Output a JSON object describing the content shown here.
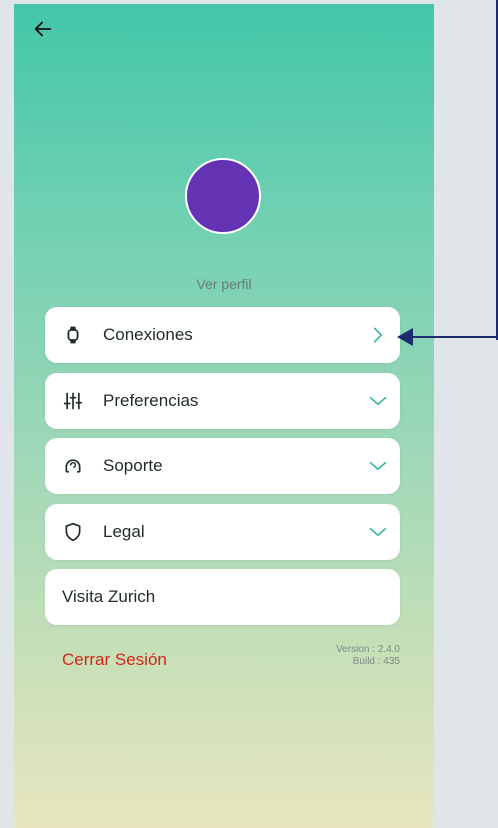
{
  "header": {
    "back_icon": "arrow-left-icon"
  },
  "profile": {
    "view_label": "Ver perfil",
    "avatar_color": "#6433b3"
  },
  "menu": [
    {
      "label": "Conexiones",
      "icon": "watch-icon",
      "indicator": "chevron-right-icon"
    },
    {
      "label": "Preferencias",
      "icon": "sliders-icon",
      "indicator": "chevron-down-icon"
    },
    {
      "label": "Soporte",
      "icon": "support-icon",
      "indicator": "chevron-down-icon"
    },
    {
      "label": "Legal",
      "icon": "shield-icon",
      "indicator": "chevron-down-icon"
    },
    {
      "label": "Visita Zurich"
    }
  ],
  "footer": {
    "logout_label": "Cerrar Sesión",
    "version": "Version : 2.4.0",
    "build": "Build : 435"
  },
  "colors": {
    "accent": "#2bb39a",
    "logout": "#d4261c",
    "callout": "#1f2c6e"
  }
}
